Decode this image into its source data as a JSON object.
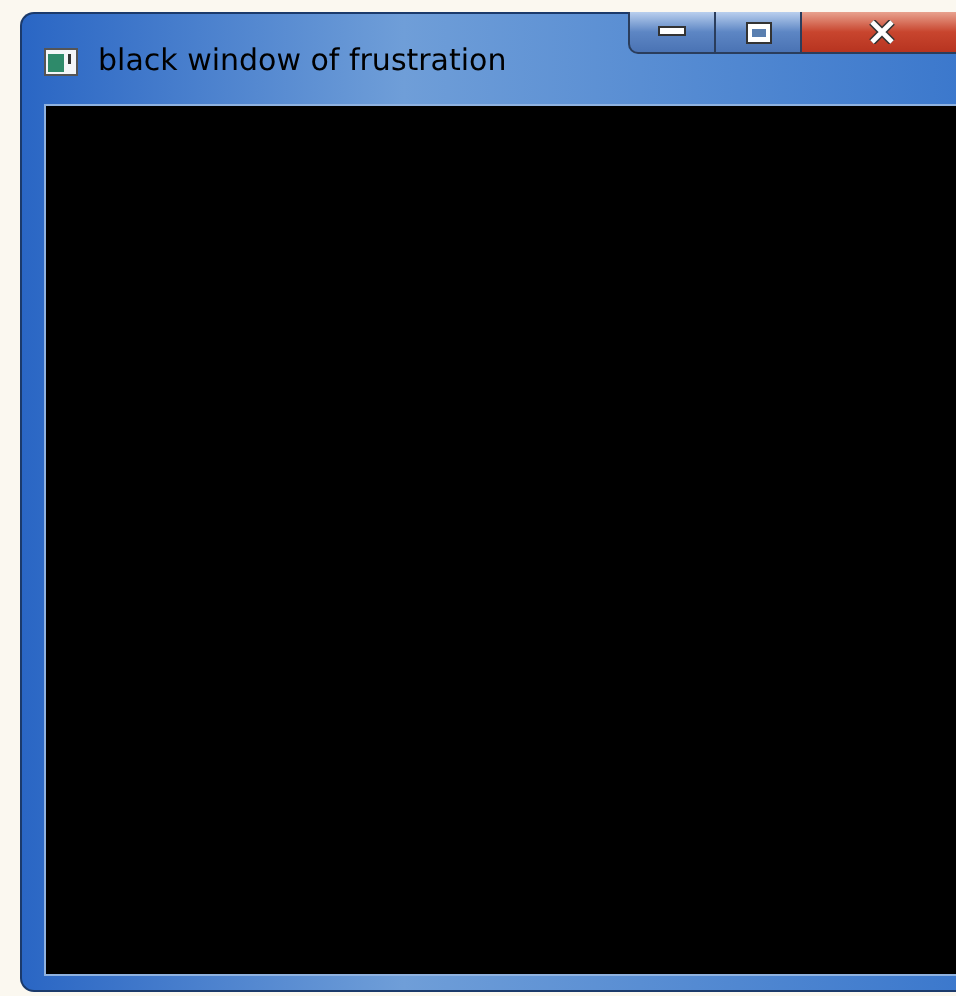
{
  "window": {
    "title": "black window of frustration"
  }
}
